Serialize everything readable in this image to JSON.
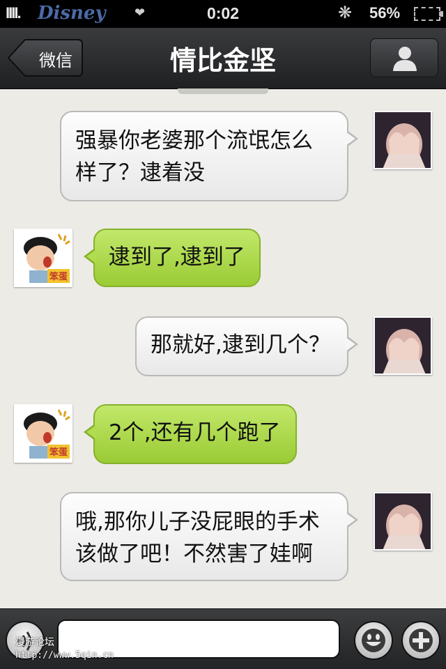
{
  "status_bar": {
    "signal": "IIII.",
    "carrier": "Disney",
    "time": "0:02",
    "battery_percent": "56%",
    "heart_icon": "heart-icon",
    "activity_icon": "sync-spinner-icon"
  },
  "nav": {
    "back_label": "微信",
    "title": "情比金坚",
    "profile_icon": "person-icon"
  },
  "messages": [
    {
      "sender": "me",
      "lines": [
        "强暴你老婆那个流氓怎么",
        "样了？逮着没"
      ]
    },
    {
      "sender": "friend",
      "lines": [
        "逮到了,逮到了"
      ]
    },
    {
      "sender": "me",
      "lines": [
        "那就好,逮到几个？"
      ]
    },
    {
      "sender": "friend",
      "lines": [
        "2个,还有几个跑了"
      ]
    },
    {
      "sender": "me",
      "lines": [
        "哦,那你儿子没屁眼的手术",
        "该做了吧！不然害了娃啊"
      ]
    }
  ],
  "friend_avatar_badge": "笨蛋",
  "input_bar": {
    "placeholder": "",
    "voice_icon": "voice-icon",
    "emoji_icon": "smiley-icon",
    "plus_icon": "plus-icon"
  },
  "watermark": {
    "line1": "漫游论坛",
    "line2": "http://www.5qin.cn"
  },
  "colors": {
    "outgoing_bubble": "#f2f2f2",
    "incoming_bubble": "#acd94a",
    "nav_bar": "#2c2d2f"
  }
}
